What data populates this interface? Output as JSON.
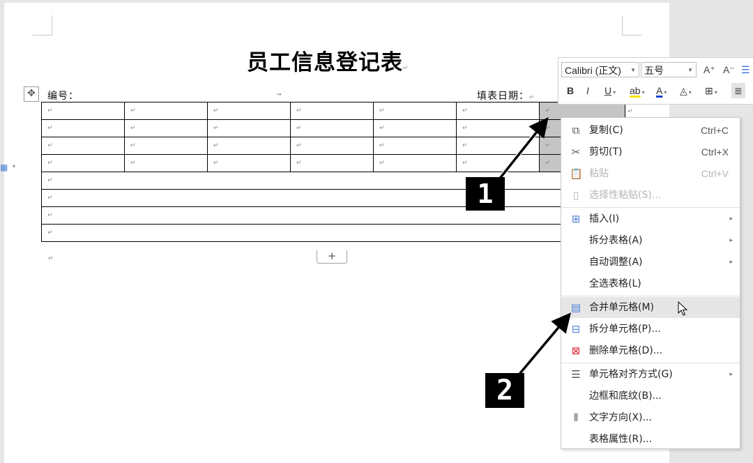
{
  "document": {
    "title": "员工信息登记表",
    "para_mark": "↵",
    "serial_label": "编号：",
    "tab_mark": "→",
    "date_label": "填表日期：",
    "add_row_label": "+",
    "table_rows": [
      [
        "↵",
        "↵",
        "↵",
        "↵",
        "↵",
        "↵",
        "↵"
      ],
      [
        "↵",
        "↵",
        "↵",
        "↵",
        "↵",
        "↵",
        "↵"
      ],
      [
        "↵",
        "↵",
        "↵",
        "↵",
        "↵",
        "↵",
        "↵"
      ],
      [
        "↵",
        "↵",
        "↵",
        "↵",
        "↵",
        "↵",
        "↵"
      ],
      [
        "↵"
      ],
      [
        "↵"
      ],
      [
        "↵"
      ],
      [
        "↵"
      ]
    ]
  },
  "mini_toolbar": {
    "font_name": "Calibri (正文)",
    "font_size": "五号",
    "grow_font": "A⁺",
    "shrink_font": "A⁻",
    "bold": "B",
    "italic": "I",
    "underline": "U",
    "highlight": "ab",
    "font_color": "A",
    "highlight_color": "#f5e400",
    "font_color_value": "#1a3fd0"
  },
  "context_menu": {
    "items": [
      {
        "label": "复制(C)",
        "shortcut": "Ctrl+C",
        "icon": "copy-icon"
      },
      {
        "label": "剪切(T)",
        "shortcut": "Ctrl+X",
        "icon": "scissors-icon"
      },
      {
        "label": "粘贴",
        "shortcut": "Ctrl+V",
        "icon": "paste-icon",
        "disabled": true
      },
      {
        "label": "选择性粘贴(S)...",
        "icon": "paste-special-icon",
        "disabled": true
      },
      {
        "label": "插入(I)",
        "icon": "table-insert-icon",
        "submenu": true
      },
      {
        "label": "拆分表格(A)",
        "submenu": true
      },
      {
        "label": "自动调整(A)",
        "submenu": true
      },
      {
        "label": "全选表格(L)"
      },
      {
        "label": "合并单元格(M)",
        "icon": "merge-cells-icon",
        "highlighted": true
      },
      {
        "label": "拆分单元格(P)...",
        "icon": "split-cells-icon"
      },
      {
        "label": "删除单元格(D)...",
        "icon": "delete-cells-icon"
      },
      {
        "label": "单元格对齐方式(G)",
        "icon": "cell-align-icon",
        "submenu": true
      },
      {
        "label": "边框和底纹(B)..."
      },
      {
        "label": "文字方向(X)...",
        "icon": "text-direction-icon"
      },
      {
        "label": "表格属性(R)..."
      }
    ]
  },
  "annotations": {
    "step1": "1",
    "step2": "2"
  }
}
